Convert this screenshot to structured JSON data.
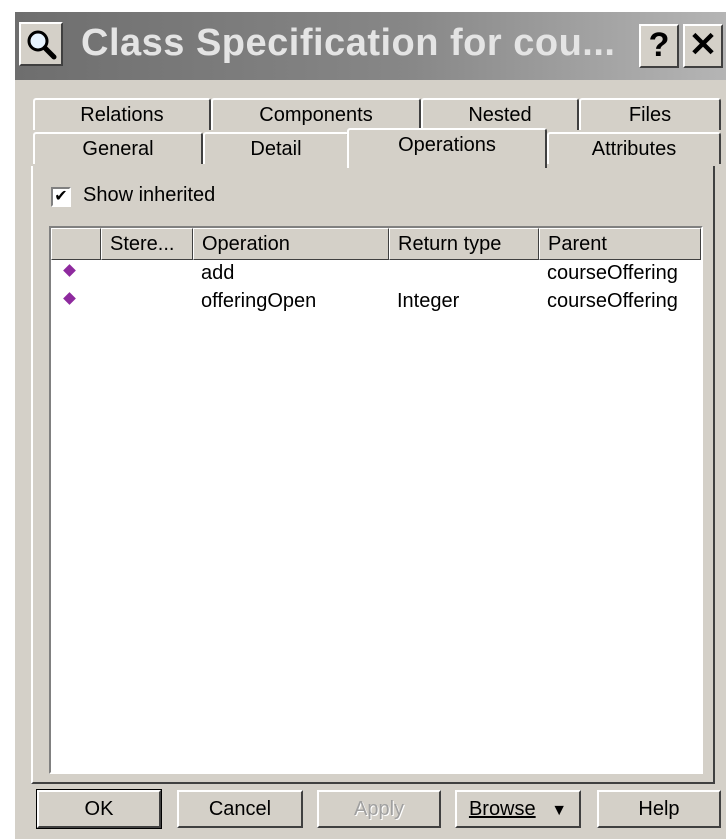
{
  "window": {
    "title": "Class Specification for cou..."
  },
  "title_buttons": {
    "help": "?",
    "close": "✕"
  },
  "tabs": {
    "back_row": [
      "Relations",
      "Components",
      "Nested",
      "Files"
    ],
    "front_row": [
      "General",
      "Detail",
      "Operations",
      "Attributes"
    ],
    "active": "Operations"
  },
  "show_inherited": {
    "label": "Show inherited",
    "checked": true,
    "mark": "✔"
  },
  "table": {
    "headers": [
      "",
      "Stere...",
      "Operation",
      "Return type",
      "Parent"
    ],
    "rows": [
      {
        "icon": "operation-icon",
        "stereotype": "",
        "operation": "add",
        "return_type": "",
        "parent": "courseOffering"
      },
      {
        "icon": "operation-icon",
        "stereotype": "",
        "operation": "offeringOpen",
        "return_type": "Integer",
        "parent": "courseOffering"
      }
    ]
  },
  "buttons": {
    "ok": "OK",
    "cancel": "Cancel",
    "apply": "Apply",
    "browse": "Browse",
    "browse_arrow": "▼",
    "help": "Help"
  },
  "colors": {
    "operation_icon": "#8e2a9e",
    "dialog_face": "#d4d0c8"
  }
}
